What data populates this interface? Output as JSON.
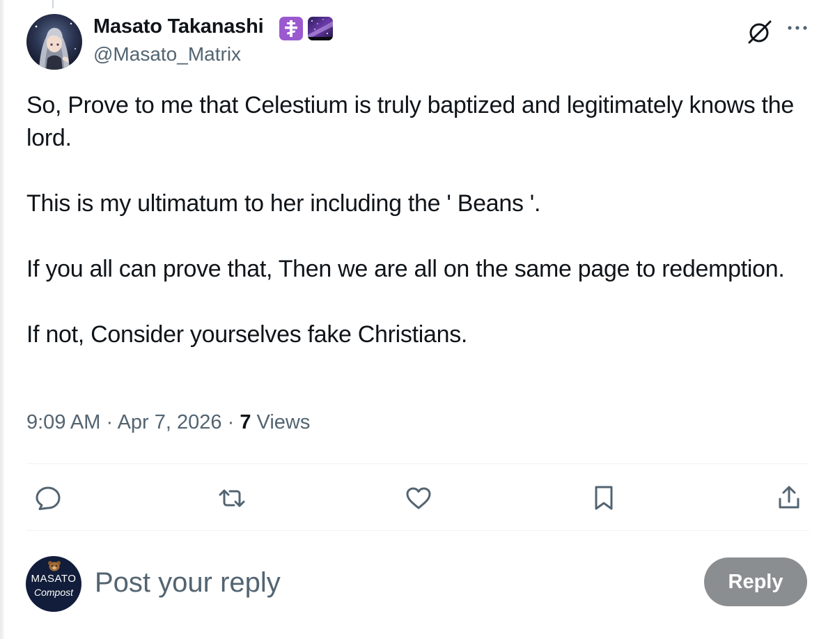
{
  "author": {
    "name": "Masato Takanashi",
    "handle": "@Masato_Matrix",
    "badges": [
      "orthodox-cross-emoji",
      "milky-way-emoji"
    ]
  },
  "tweet": {
    "paragraphs": [
      "So, Prove to me that Celestium is truly baptized and legitimately knows the lord.",
      "This is my ultimatum to her including the ' Beans '.",
      "If you all can prove that, Then we are all on the same page to redemption.",
      "If not, Consider yourselves fake Christians."
    ],
    "time": "9:09 AM",
    "separator": " · ",
    "date": "Apr 7, 2026",
    "views_count": "7",
    "views_label": " Views"
  },
  "actions": [
    "reply-icon",
    "retweet-icon",
    "like-icon",
    "bookmark-icon",
    "share-icon"
  ],
  "reply_box": {
    "avatar_line1": "MASATO",
    "avatar_line2": "Compost",
    "placeholder": "Post your reply",
    "button_label": "Reply"
  },
  "colors": {
    "primary_text": "#0f1419",
    "secondary_text": "#536471",
    "divider": "#eff3f4",
    "reply_button_disabled": "#8b8e91"
  }
}
